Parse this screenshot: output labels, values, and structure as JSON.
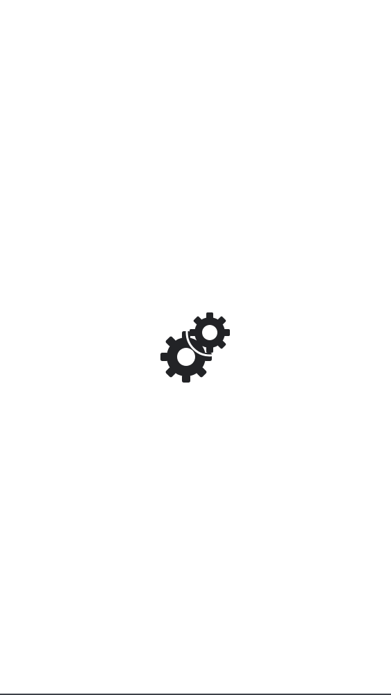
{
  "splash": {
    "icon": "gears-icon",
    "icon_color": "#222326",
    "background_color": "#ffffff",
    "bottom_edge_color": "#3c4148"
  }
}
